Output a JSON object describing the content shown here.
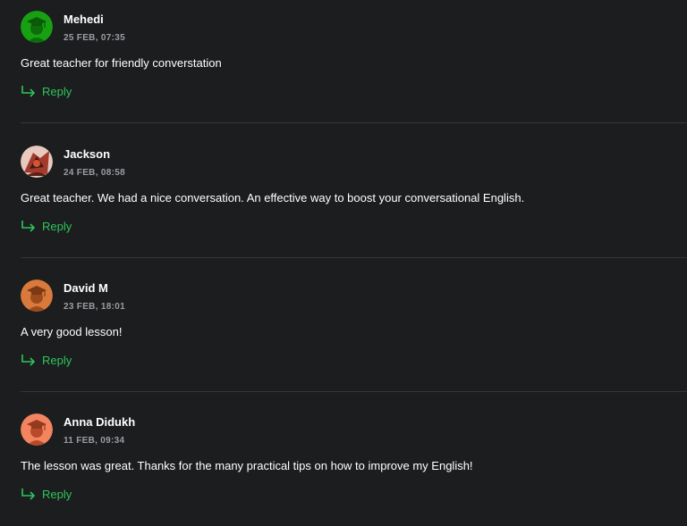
{
  "reply_label": "Reply",
  "colors": {
    "background": "#1c1d1f",
    "accent_green": "#2ec55a",
    "date_gray": "#9a9da3"
  },
  "reviews": [
    {
      "author": "Mehedi",
      "date": "25 FEB, 07:35",
      "text": "Great teacher for friendly converstation",
      "avatar_icon": "graduation-cap-icon",
      "avatar_color": "#16a012"
    },
    {
      "author": "Jackson",
      "date": "24 FEB, 08:58",
      "text": "Great teacher. We had a nice conversation. An effective way to boost your conversational English.",
      "avatar_icon": "user-photo",
      "avatar_color": "#a33a2c"
    },
    {
      "author": "David M",
      "date": "23 FEB, 18:01",
      "text": "A very good lesson!",
      "avatar_icon": "graduation-cap-icon",
      "avatar_color": "#d97a3c"
    },
    {
      "author": "Anna Didukh",
      "date": "11 FEB, 09:34",
      "text": "The lesson was great. Thanks for the many practical tips on how to improve my English!",
      "avatar_icon": "graduation-cap-icon",
      "avatar_color": "#f2845f"
    }
  ]
}
